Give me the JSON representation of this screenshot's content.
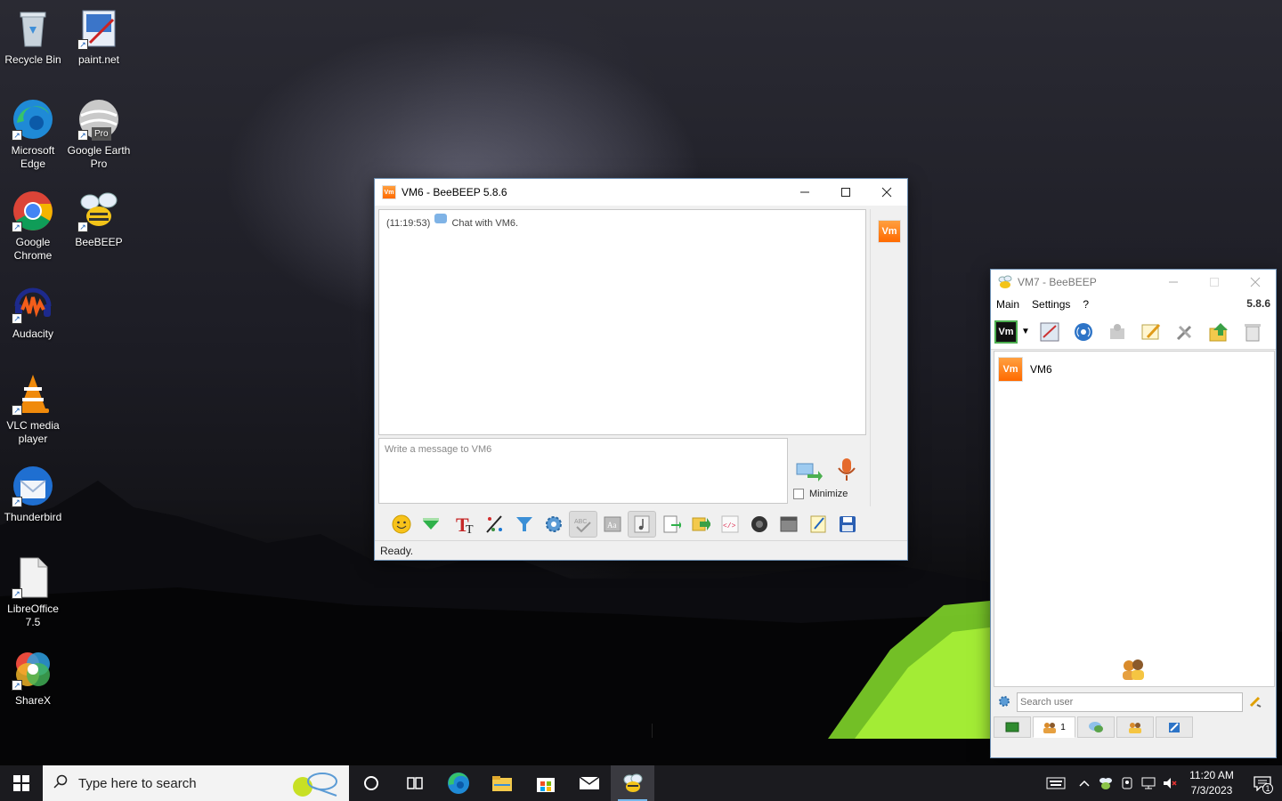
{
  "desktop": {
    "icons": [
      {
        "label": "Recycle Bin"
      },
      {
        "label": "paint.net"
      },
      {
        "label": "Microsoft Edge"
      },
      {
        "label": "Google Earth Pro"
      },
      {
        "label": "Google Chrome"
      },
      {
        "label": "BeeBEEP"
      },
      {
        "label": "Audacity"
      },
      {
        "label": "VLC media player"
      },
      {
        "label": "Thunderbird"
      },
      {
        "label": "LibreOffice 7.5"
      },
      {
        "label": "ShareX"
      }
    ],
    "earth_pro_badge": "Pro"
  },
  "chat_window": {
    "title": "VM6 - BeeBEEP 5.8.6",
    "app_badge": "Vm",
    "log": {
      "timestamp": "(11:19:53)",
      "message": "Chat with VM6."
    },
    "input_placeholder": "Write a message to VM6",
    "minimize_label": "Minimize",
    "status": "Ready.",
    "toolbar_icons": [
      "emoticon-icon",
      "green-arrow-icon",
      "text-font-icon",
      "text-color-icon",
      "filter-icon",
      "settings-icon",
      "spellcheck-icon",
      "font-icon",
      "music-note-icon",
      "save-chat-icon",
      "send-file-icon",
      "html-code-icon",
      "screenshot-icon",
      "window-icon",
      "notes-icon",
      "save-icon"
    ]
  },
  "main_window": {
    "title": "VM7 - BeeBEEP",
    "menu": {
      "main": "Main",
      "settings": "Settings",
      "help": "?"
    },
    "version": "5.8.6",
    "profile_badge": "Vm",
    "users": [
      {
        "name": "VM6",
        "badge": "Vm"
      }
    ],
    "search_placeholder": "Search user",
    "tabs": [
      {
        "name": "home-tab",
        "label": ""
      },
      {
        "name": "users-tab",
        "label": "1"
      },
      {
        "name": "chats-tab",
        "label": ""
      },
      {
        "name": "groups-tab",
        "label": ""
      },
      {
        "name": "files-tab",
        "label": ""
      }
    ]
  },
  "taskbar": {
    "search_placeholder": "Type here to search",
    "time": "11:20 AM",
    "date": "7/3/2023",
    "notification_count": "1"
  }
}
